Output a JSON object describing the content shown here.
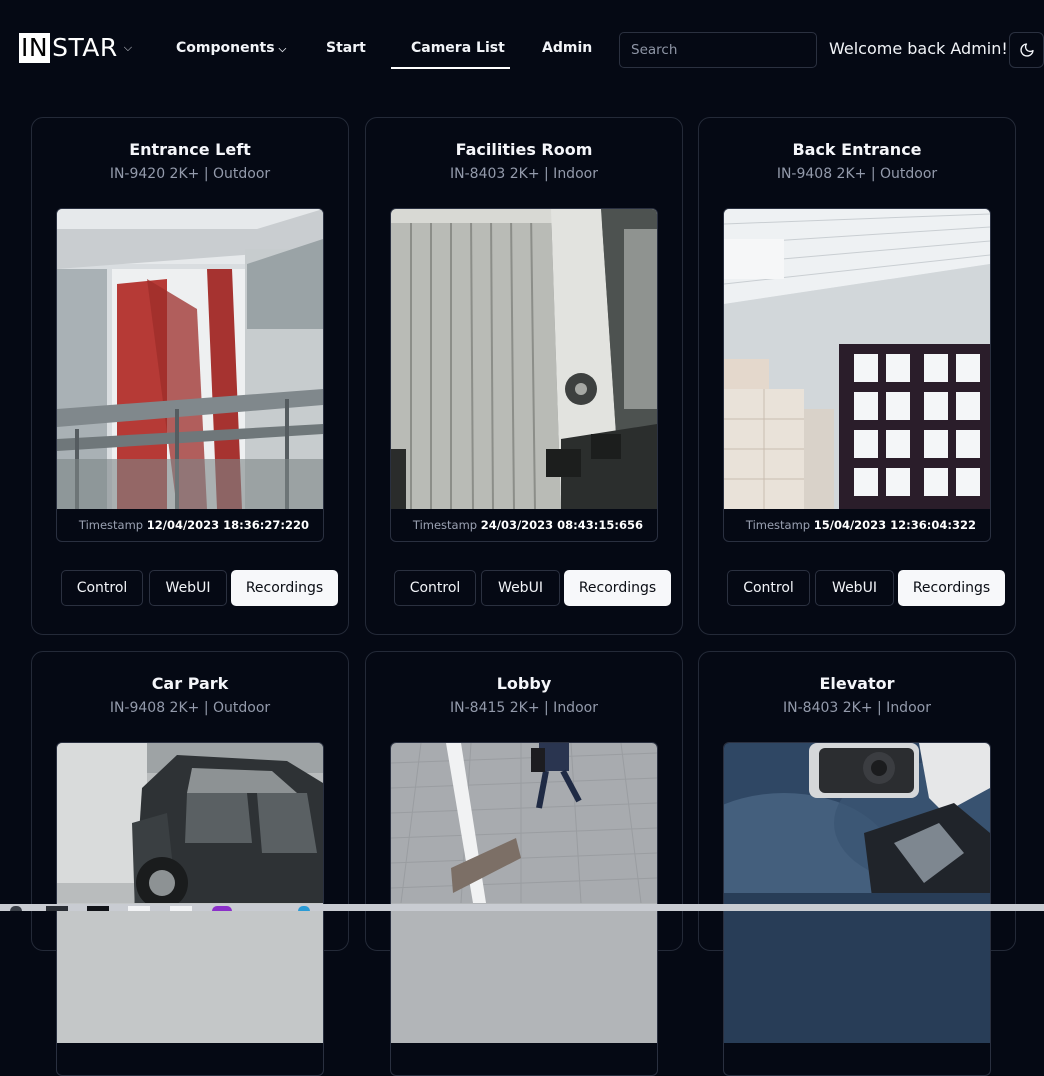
{
  "header": {
    "logo_prefix": "IN",
    "logo_suffix": "STAR",
    "nav": [
      {
        "label": "Components",
        "has_dropdown": true
      },
      {
        "label": "Start"
      },
      {
        "label": "Camera List",
        "active": true
      },
      {
        "label": "Admin"
      }
    ],
    "search_placeholder": "Search",
    "welcome": "Welcome back Admin!",
    "theme_toggle_icon": "moon-icon"
  },
  "cameras": [
    {
      "name": "Entrance Left",
      "subtitle": "IN-9420 2K+ | Outdoor",
      "timestamp_label": "Timestamp",
      "timestamp": "12/04/2023 18:36:27:220"
    },
    {
      "name": "Facilities Room",
      "subtitle": "IN-8403 2K+ | Indoor",
      "timestamp_label": "Timestamp",
      "timestamp": "24/03/2023 08:43:15:656"
    },
    {
      "name": "Back Entrance",
      "subtitle": "IN-9408 2K+ | Outdoor",
      "timestamp_label": "Timestamp",
      "timestamp": "15/04/2023 12:36:04:322"
    },
    {
      "name": "Car Park",
      "subtitle": "IN-9408 2K+ | Outdoor"
    },
    {
      "name": "Lobby",
      "subtitle": "IN-8415 2K+ | Indoor"
    },
    {
      "name": "Elevator",
      "subtitle": "IN-8403 2K+ | Indoor"
    }
  ],
  "card_actions": {
    "control": "Control",
    "webui": "WebUI",
    "recordings": "Recordings"
  },
  "colors": {
    "background": "#050914",
    "card_border": "#242a38",
    "primary_button": "#f7f8fa",
    "muted_text": "#939aab"
  }
}
